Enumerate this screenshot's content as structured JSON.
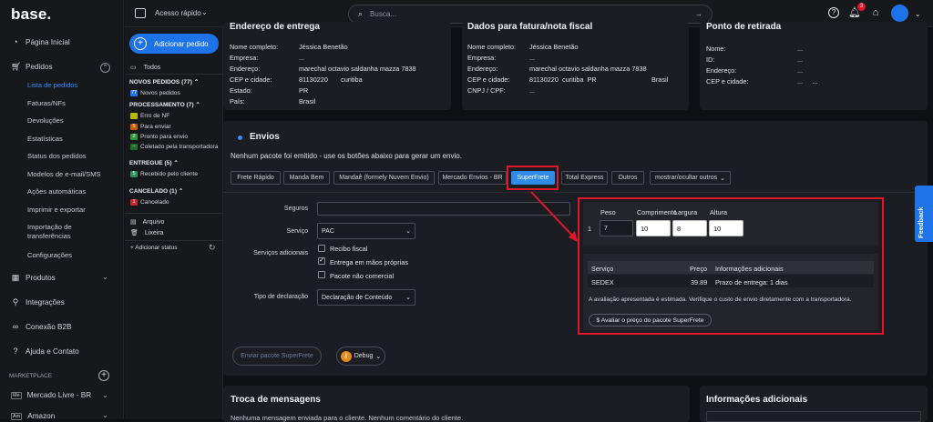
{
  "app": {
    "logo": "base."
  },
  "nav": {
    "home": "Página Inicial",
    "orders": "Pedidos",
    "orders_sub": [
      "Lista de pedidos",
      "Faturas/NFs",
      "Devoluções",
      "Estatísticas",
      "Status dos pedidos",
      "Modelos de e-mail/SMS",
      "Ações automáticas",
      "Imprimir e exportar",
      "Importação de",
      "transferências",
      "Configurações"
    ],
    "products": "Produtos",
    "integrations": "Integrações",
    "b2b": "Conexão B2B",
    "help": "Ajuda e Contato",
    "marketplace": "MARKETPLACE",
    "mercado": "Mercado Livre - BR",
    "mercado_abbr": "Me",
    "amazon": "Amazon",
    "amazon_abbr": "Am"
  },
  "topbar": {
    "quick_access": "Acesso rápido",
    "search_placeholder": "Busca...",
    "notif_count": "3"
  },
  "panel2": {
    "add_order": "Adicionar pedido",
    "all": "Todos",
    "new_header": "NOVOS PEDIDOS (77)",
    "new_items": [
      {
        "badge": "77",
        "label": "Novos pedidos",
        "color": "#1e73e8"
      }
    ],
    "proc_header": "PROCESSAMENTO (7)",
    "proc_items": [
      {
        "badge": "",
        "label": "Erro de NF",
        "color": "#b8b800"
      },
      {
        "badge": "5",
        "label": "Para enviar",
        "color": "#c85a00"
      },
      {
        "badge": "2",
        "label": "Pronto para envio",
        "color": "#2f9b36"
      },
      {
        "badge": "",
        "label": "Coletado pela transportadora",
        "color": "#1f6f2a"
      }
    ],
    "delivered_header": "ENTREGUE (5)",
    "delivered_items": [
      {
        "badge": "5",
        "label": "Recebido pelo cliente",
        "color": "#2a8f5a"
      }
    ],
    "cancel_header": "CANCELADO (1)",
    "cancel_items": [
      {
        "badge": "1",
        "label": "Cancelado",
        "color": "#c0282d"
      }
    ],
    "archive": "Arquivo",
    "trash": "Lixeira",
    "add_status": "+ Adicionar status"
  },
  "delivery": {
    "title": "Endereço de entrega",
    "labels": [
      "Nome completo:",
      "Empresa:",
      "Endereço:",
      "CEP e cidade:",
      "Estado:",
      "País:"
    ],
    "values": [
      "Jéssica Benetão",
      "...",
      "marechal octavio saldanha mazza 7838",
      "81130220       curitiba",
      "PR",
      "Brasil"
    ]
  },
  "billing": {
    "title": "Dados para fatura/nota fiscal",
    "labels": [
      "Nome completo:",
      "Empresa:",
      "Endereço:",
      "CEP e cidade:",
      "CNPJ / CPF:"
    ],
    "values": [
      "Jéssica Benetão",
      "...",
      "marechal octavio saldanha mazza 7838",
      "81130220  curitiba  PR",
      "..."
    ],
    "country": "Brasil"
  },
  "pickup": {
    "title": "Ponto de retirada",
    "labels": [
      "Nome:",
      "ID:",
      "Endereço:",
      "CEP e cidade:"
    ],
    "values": [
      "...",
      "...",
      "...",
      "...     ..."
    ]
  },
  "envios": {
    "title": "Envios",
    "notice": "Nenhum pacote foi emitido - use os botões abaixo para gerar um envio.",
    "tabs": [
      "Frete Rápido",
      "Manda Bem",
      "Mandaê (formely Nuvem Envio)",
      "Mercado Envios - BR",
      "SuperFrete",
      "Total Express",
      "Outros",
      "mostrar/ocultar outros"
    ],
    "active_tab": "SuperFrete",
    "form": {
      "seguros": "Seguros",
      "servico": "Serviço",
      "servico_value": "PAC",
      "servicos_adicionais": "Serviços adicionais",
      "options": [
        {
          "label": "Recibo fiscal",
          "checked": false
        },
        {
          "label": "Entrega em mãos próprias",
          "checked": true
        },
        {
          "label": "Pacote não comercial",
          "checked": false
        }
      ],
      "tipo_declaracao": "Tipo de declaração",
      "tipo_value": "Declaração de Conteúdo"
    },
    "send_button": "Enviar pacote SuperFrete",
    "debug_button": "Debug",
    "package": {
      "headers": [
        "Peso",
        "Comprimento",
        "Largura",
        "Altura"
      ],
      "row_index": "1",
      "values": [
        "7",
        "10",
        "8",
        "10"
      ]
    },
    "quote": {
      "headers": [
        "Serviço",
        "Preço",
        "Informações adicionais"
      ],
      "row": {
        "service": "SEDEX",
        "price": "39.89",
        "info": "Prazo de entrega: 1 dias"
      },
      "note": "A avaliação apresentada é estimada. Verifique o custo de envio diretamente com a transportadora.",
      "button": "$ Avaliar o preço do pacote SuperFrete"
    }
  },
  "messages": {
    "title": "Troca de mensagens",
    "body": "Nenhuma mensagem enviada para o cliente. Nenhum comentário do cliente."
  },
  "extra": {
    "title": "Informações adicionais"
  },
  "feedback": "Feedback",
  "colors": {
    "accent": "#1e73e8",
    "highlight": "#e0182b",
    "bg": "#0f1013",
    "panel": "#1c1d22"
  }
}
